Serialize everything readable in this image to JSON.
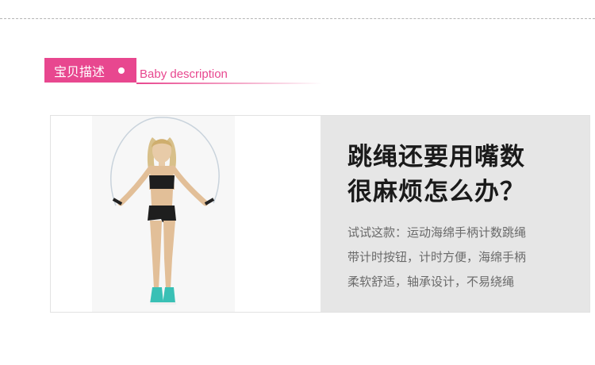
{
  "section_header": {
    "tag_label": "宝贝描述",
    "english_label": "Baby description"
  },
  "colors": {
    "accent": "#e8478f",
    "panel_background": "#e6e6e6",
    "headline_text": "#1a1a1a",
    "body_text": "#6a6a6a"
  },
  "product": {
    "image_icon": "woman-jumping-rope-photo",
    "headline_lines": [
      "跳绳还要用嘴数",
      "很麻烦怎么办？"
    ],
    "description_lines": [
      "试试这款：运动海绵手柄计数跳绳",
      "带计时按钮，计时方便，海绵手柄",
      "柔软舒适，轴承设计，不易绕绳"
    ]
  }
}
